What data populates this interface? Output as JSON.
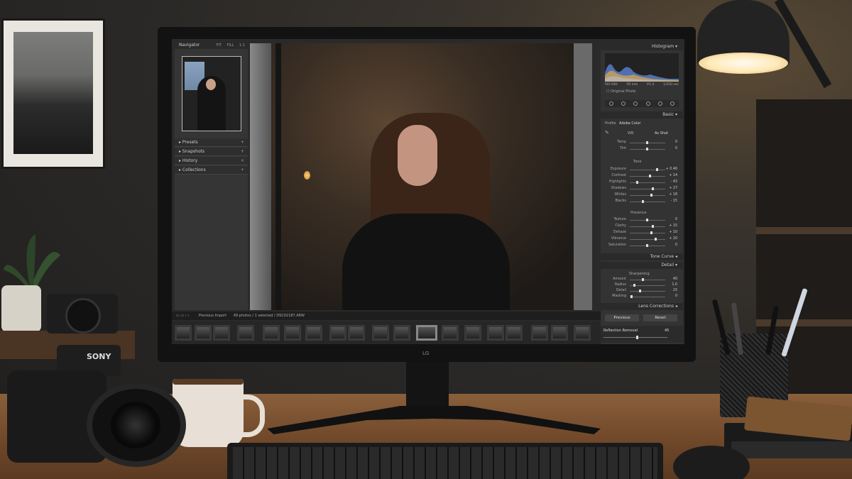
{
  "lightroom": {
    "left_panel": {
      "navigator": {
        "label": "Navigator",
        "zoom_options": [
          "FIT",
          "FILL",
          "1:1"
        ]
      },
      "panels": [
        {
          "label": "Presets"
        },
        {
          "label": "Snapshots"
        },
        {
          "label": "History"
        },
        {
          "label": "Collections"
        }
      ]
    },
    "filmstrip_bar": {
      "source": "Previous Import",
      "selection": "49 photos / 1 selected / DSC02187.ARW"
    },
    "right_panel": {
      "histogram": {
        "label": "Histogram",
        "values": [
          "ISO 640",
          "50 mm",
          "f/1.4",
          "1/250 sec"
        ],
        "original_photo": "Original Photo"
      },
      "basic": {
        "label": "Basic",
        "profile_label": "Profile",
        "profile_value": "Adobe Color",
        "wb_label": "WB",
        "wb_value": "As Shot",
        "temp": {
          "label": "Temp",
          "value": "0"
        },
        "tint": {
          "label": "Tint",
          "value": "0"
        },
        "tone_label": "Tone",
        "tone_sliders": [
          {
            "label": "Exposure",
            "value": "+ 0.46"
          },
          {
            "label": "Contrast",
            "value": "+ 14"
          },
          {
            "label": "Highlights",
            "value": "- 43"
          },
          {
            "label": "Shadows",
            "value": "+ 27"
          },
          {
            "label": "Whites",
            "value": "+ 18"
          },
          {
            "label": "Blacks",
            "value": "- 15"
          }
        ],
        "presence_label": "Presence",
        "presence_sliders": [
          {
            "label": "Texture",
            "value": "0"
          },
          {
            "label": "Clarity",
            "value": "+ 15"
          },
          {
            "label": "Dehaze",
            "value": "+ 10"
          },
          {
            "label": "Vibrance",
            "value": "+ 20"
          },
          {
            "label": "Saturation",
            "value": "0"
          }
        ]
      },
      "tone_curve": {
        "label": "Tone Curve"
      },
      "detail": {
        "label": "Detail",
        "sharpening_label": "Sharpening",
        "sliders": [
          {
            "label": "Amount",
            "value": "40"
          },
          {
            "label": "Radius",
            "value": "1.0"
          },
          {
            "label": "Detail",
            "value": "25"
          },
          {
            "label": "Masking",
            "value": "0"
          }
        ]
      },
      "lens_corrections": {
        "label": "Lens Corrections"
      },
      "buttons": {
        "previous": "Previous",
        "reset": "Reset"
      },
      "reflection_removal": {
        "label": "Reflection Removal",
        "value": "45"
      }
    }
  },
  "scene": {
    "monitor_logo": "LG",
    "camera_brand": "SONY"
  }
}
